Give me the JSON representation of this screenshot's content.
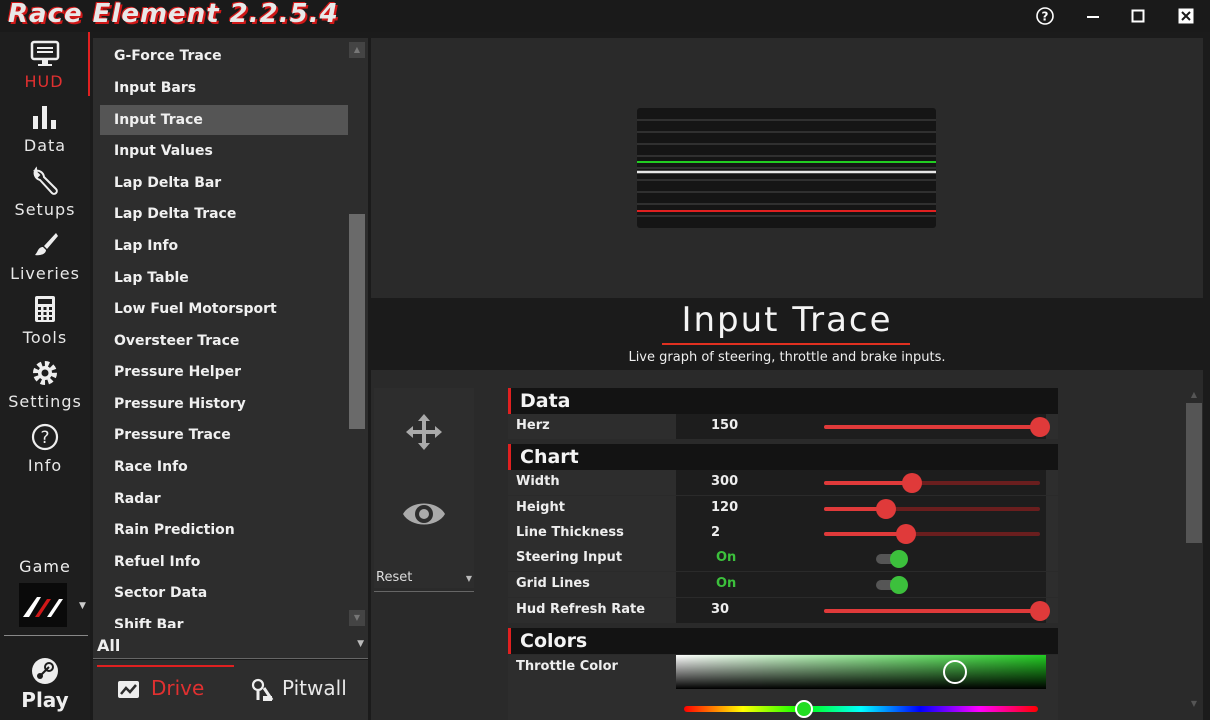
{
  "app": {
    "title": "Race Element 2.2.5.4"
  },
  "window": {
    "help_icon": "help-circle-icon",
    "minimize_icon": "minimize-icon",
    "maximize_icon": "maximize-icon",
    "close_icon": "close-icon"
  },
  "nav": {
    "items": [
      {
        "label": "HUD",
        "icon": "monitor-icon",
        "active": true
      },
      {
        "label": "Data",
        "icon": "bar-chart-icon"
      },
      {
        "label": "Setups",
        "icon": "wrench-icon"
      },
      {
        "label": "Liveries",
        "icon": "brush-icon"
      },
      {
        "label": "Tools",
        "icon": "calculator-icon"
      },
      {
        "label": "Settings",
        "icon": "gear-icon"
      },
      {
        "label": "Info",
        "icon": "question-icon"
      }
    ],
    "game_label": "Game",
    "play_label": "Play"
  },
  "overlay_list": {
    "items": [
      "G-Force Trace",
      "Input Bars",
      "Input Trace",
      "Input Values",
      "Lap Delta Bar",
      "Lap Delta Trace",
      "Lap Info",
      "Lap Table",
      "Low Fuel Motorsport",
      "Oversteer Trace",
      "Pressure Helper",
      "Pressure History",
      "Pressure Trace",
      "Race Info",
      "Radar",
      "Rain Prediction",
      "Refuel Info",
      "Sector Data",
      "Shift Bar"
    ],
    "selected": "Input Trace",
    "filter": "All"
  },
  "bottom_tabs": {
    "drive": "Drive",
    "pitwall": "Pitwall"
  },
  "hud": {
    "title": "Input Trace",
    "description": "Live graph of steering, throttle and brake inputs.",
    "reset_label": "Reset"
  },
  "sections": {
    "data": {
      "title": "Data",
      "rows": {
        "herz": {
          "label": "Herz",
          "value": "150",
          "fraction": 1.0
        }
      }
    },
    "chart": {
      "title": "Chart",
      "rows": {
        "width": {
          "label": "Width",
          "value": "300",
          "fraction": 0.38
        },
        "height": {
          "label": "Height",
          "value": "120",
          "fraction": 0.25
        },
        "line_thickness": {
          "label": "Line Thickness",
          "value": "2",
          "fraction": 0.35
        },
        "steering_input": {
          "label": "Steering Input",
          "value": "On"
        },
        "grid_lines": {
          "label": "Grid Lines",
          "value": "On"
        },
        "hud_refresh_rate": {
          "label": "Hud Refresh Rate",
          "value": "30",
          "fraction": 1.0
        }
      }
    },
    "colors": {
      "title": "Colors",
      "rows": {
        "throttle_color": {
          "label": "Throttle Color",
          "color": "#22cc22"
        }
      }
    }
  },
  "colors": {
    "accent": "#e02020",
    "on": "#3cc03c",
    "throttle": "#22cc22",
    "brake": "#e02020",
    "steering": "#e8e8e8"
  }
}
